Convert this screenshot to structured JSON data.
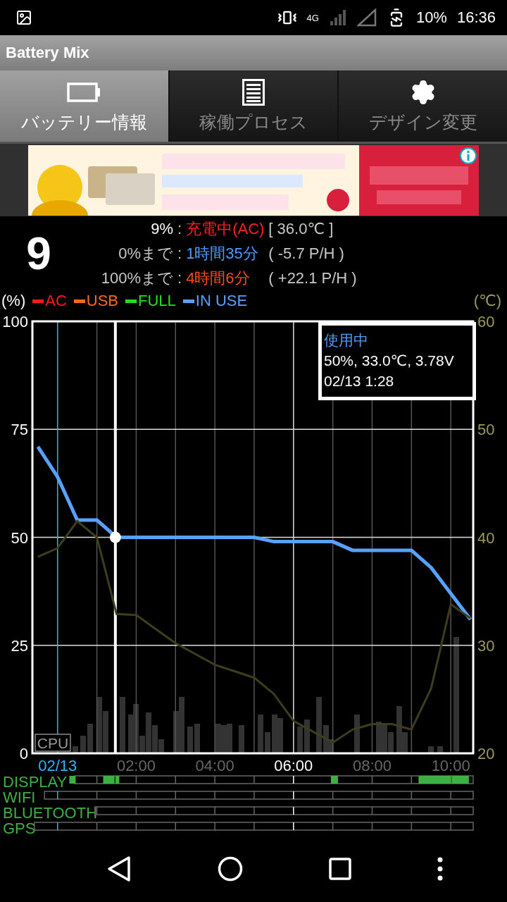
{
  "status_bar": {
    "network": "4G",
    "battery": "10%",
    "time": "16:36"
  },
  "app_bar": {
    "title": "Battery Mix"
  },
  "tabs": [
    {
      "label": "バッテリー情報",
      "selected": true
    },
    {
      "label": "稼働プロセス",
      "selected": false
    },
    {
      "label": "デザイン変更",
      "selected": false
    }
  ],
  "summary": {
    "level_digit": "9",
    "rows": [
      {
        "label": {
          "text": "9%",
          "color": "#ffffff"
        },
        "separator": ":",
        "value": {
          "text": "充電中(AC)",
          "color": "#ff2020"
        },
        "detail": "[ 36.0℃ ]"
      },
      {
        "label": {
          "text": "0%まで",
          "color": "#c8c8c8"
        },
        "separator": ":",
        "value": {
          "text": "1時間35分",
          "color": "#4e9cff"
        },
        "detail": "( -5.7 P/H )"
      },
      {
        "label": {
          "text": "100%まで",
          "color": "#c8c8c8"
        },
        "separator": ":",
        "value": {
          "text": "4時間6分",
          "color": "#ff4a1a"
        },
        "detail": "( +22.1 P/H )"
      }
    ]
  },
  "chart": {
    "cpu_label": "CPU",
    "chart_data": {
      "type": "line",
      "ylabel": "(%)",
      "grid": true,
      "x": [
        -0.5,
        0,
        0.5,
        1,
        1.5,
        2,
        2.5,
        3,
        3.5,
        4,
        4.5,
        5,
        5.5,
        6,
        6.5,
        7,
        7.5,
        8,
        8.5,
        9,
        9.5,
        10,
        10.5
      ],
      "xlim": [
        -0.64,
        10.57
      ],
      "ylim": [
        0,
        100
      ],
      "y2lim": [
        20,
        60
      ],
      "xticks": [
        {
          "value": 0,
          "label": "02/13"
        },
        {
          "value": 2,
          "label": "02:00"
        },
        {
          "value": 4,
          "label": "04:00"
        },
        {
          "value": 6,
          "label": "06:00"
        },
        {
          "value": 8,
          "label": "08:00"
        },
        {
          "value": 10,
          "label": "10:00"
        }
      ],
      "yticks": [
        0,
        25,
        50,
        75,
        100
      ],
      "y2ticks": [
        20,
        30,
        40,
        50,
        60
      ],
      "series": [
        {
          "name": "AC",
          "color": "#ff1a1a",
          "values": [
            null,
            null,
            null,
            null,
            null,
            null,
            null,
            null,
            null,
            null,
            null,
            null,
            null,
            null,
            null,
            null,
            null,
            null,
            null,
            null,
            null,
            null,
            null
          ]
        },
        {
          "name": "USB",
          "color": "#ff6a10",
          "values": [
            null,
            null,
            null,
            null,
            null,
            null,
            null,
            null,
            null,
            null,
            null,
            null,
            null,
            null,
            null,
            null,
            null,
            null,
            null,
            null,
            null,
            null,
            null
          ]
        },
        {
          "name": "FULL",
          "color": "#20e020",
          "values": [
            null,
            null,
            null,
            null,
            null,
            null,
            null,
            null,
            null,
            null,
            null,
            null,
            null,
            null,
            null,
            null,
            null,
            null,
            null,
            null,
            null,
            null,
            null
          ]
        },
        {
          "name": "IN USE",
          "color": "#5aa0ff",
          "values": [
            71,
            64,
            54,
            54,
            50,
            50,
            50,
            50,
            50,
            50,
            50,
            50,
            49,
            49,
            49,
            49,
            47,
            47,
            47,
            47,
            43,
            37,
            31
          ]
        },
        {
          "name": "(℃)",
          "color": "#3e3e1c",
          "axis": "y2",
          "values": [
            38.2,
            39,
            41.5,
            40,
            32.9,
            32.8,
            31.5,
            30.2,
            29.2,
            28.2,
            27.6,
            27,
            25.5,
            23,
            22,
            21,
            22.2,
            22.7,
            22.7,
            22.2,
            26,
            33.8,
            32.5
          ]
        }
      ],
      "ref_lines": [
        {
          "axis": "x",
          "value": 0,
          "color": "#29b6f6"
        },
        {
          "axis": "x",
          "value": 1.47,
          "color": "#ffffff"
        }
      ],
      "annotations": [
        "使用中\n50%, 33.0℃, 3.78V\n02/13 1:28"
      ]
    },
    "lanes": [
      {
        "label": "DISPLAY"
      },
      {
        "label": "WIFI"
      },
      {
        "label": "BLUETOOTH"
      },
      {
        "label": "GPS"
      }
    ]
  }
}
